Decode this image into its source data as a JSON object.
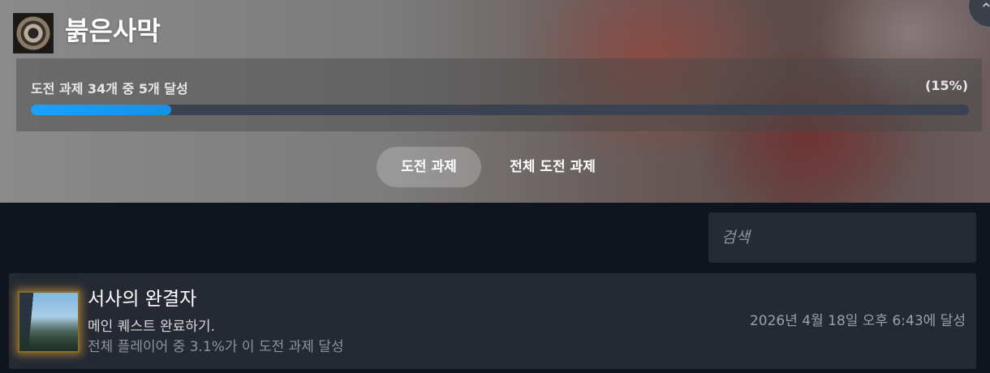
{
  "game": {
    "title": "붉은사막"
  },
  "progress": {
    "label": "도전 과제 34개 중 5개 달성",
    "percent_text": "(15%)",
    "fraction": 0.15
  },
  "tabs": [
    {
      "label": "도전 과제",
      "active": true
    },
    {
      "label": "전체 도전 과제",
      "active": false
    }
  ],
  "search": {
    "placeholder": "검색",
    "value": ""
  },
  "achievements": [
    {
      "title": "서사의 완결자",
      "description": "메인 퀘스트 완료하기.",
      "global_rate": "전체 플레이어 중 3.1%가 이 도전 과제 달성",
      "unlocked": "2026년 4월 18일 오후 6:43에 달성"
    }
  ],
  "colors": {
    "progress_fill": "#1aa2ff",
    "progress_track": "#3b4352",
    "page_background": "#0f151e",
    "row_background": "#242933",
    "icon_glow": "#d2a03c"
  },
  "icons": {
    "close": "chevron-up-icon",
    "app": "game-logo-icon"
  }
}
